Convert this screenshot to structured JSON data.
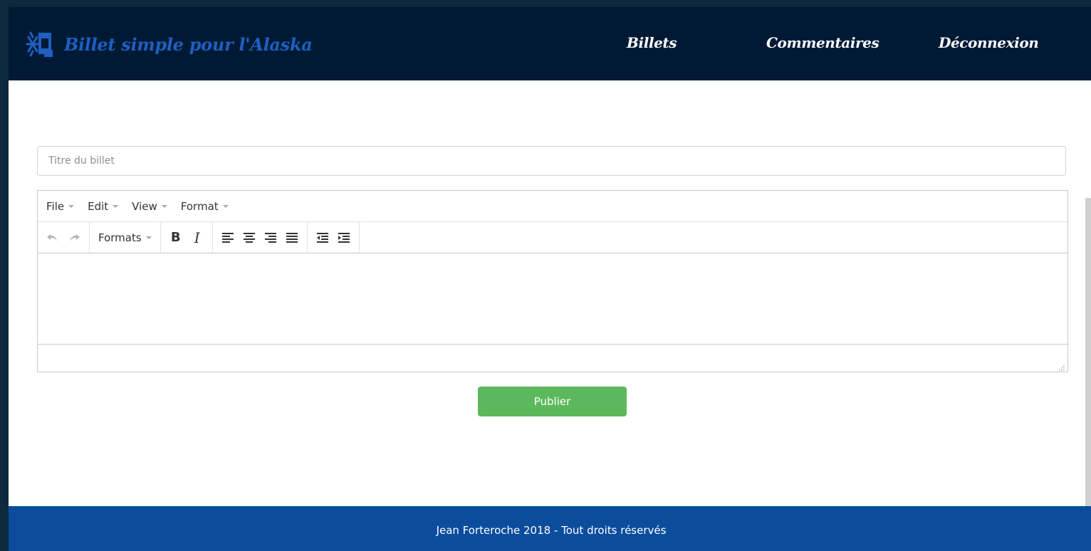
{
  "colors": {
    "navbar_bg": "#001a36",
    "brand_text": "#1f5fbf",
    "footer_bg": "#0c4c9c",
    "publish_button": "#5cb85c"
  },
  "header": {
    "brand_icon": "snowflake-document-icon",
    "brand_title": "Billet simple pour l'Alaska",
    "nav": {
      "billets": "Billets",
      "commentaires": "Commentaires",
      "deconnexion": "Déconnexion"
    }
  },
  "form": {
    "title_placeholder": "Titre du billet",
    "title_value": "",
    "editor": {
      "menus": [
        "File",
        "Edit",
        "View",
        "Format"
      ],
      "toolbar": {
        "undo_icon": "undo-icon",
        "redo_icon": "redo-icon",
        "formats_label": "Formats",
        "bold_label": "B",
        "italic_label": "I",
        "align_icons": [
          "align-left-icon",
          "align-center-icon",
          "align-right-icon",
          "align-justify-icon"
        ],
        "indent_icons": [
          "outdent-icon",
          "indent-icon"
        ]
      },
      "content": ""
    },
    "publish_label": "Publier"
  },
  "footer": {
    "text": "Jean Forteroche 2018 - Tout droits réservés"
  }
}
